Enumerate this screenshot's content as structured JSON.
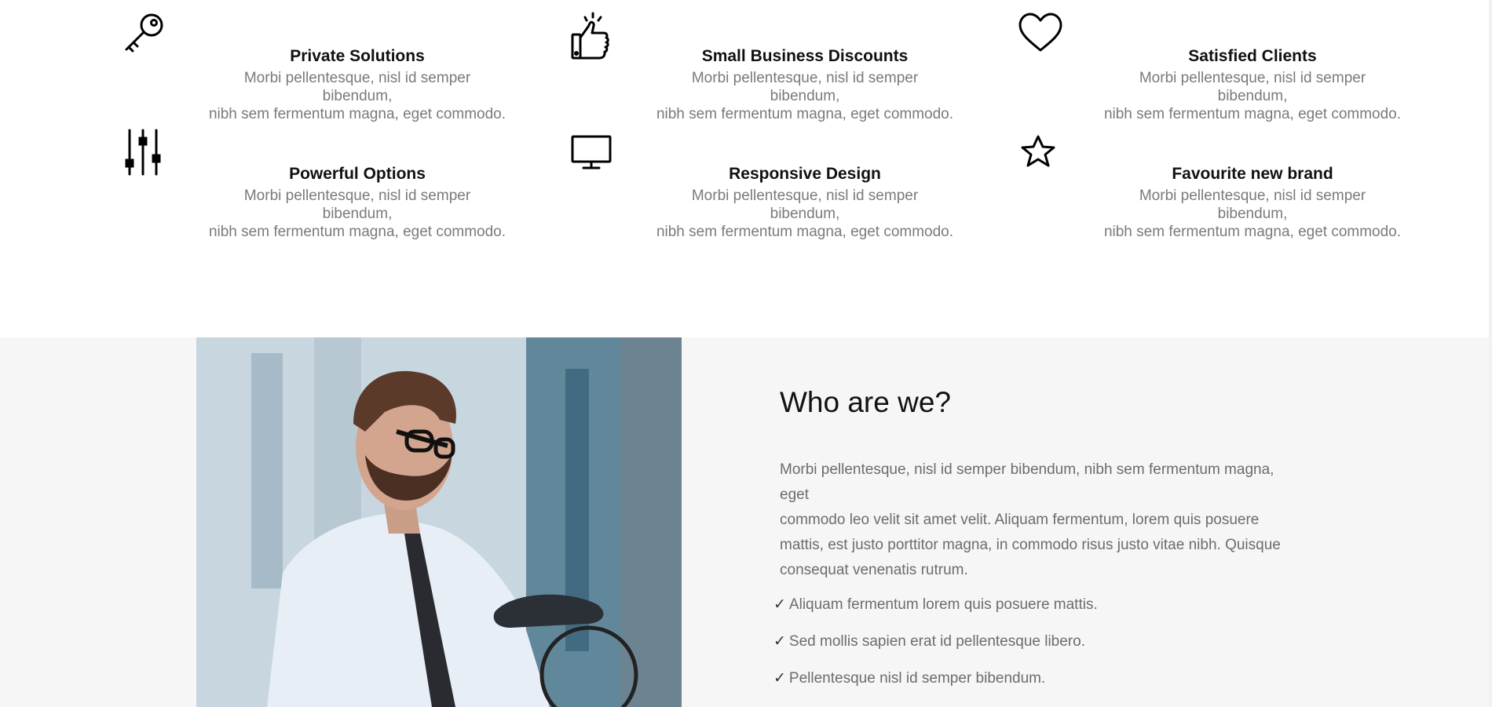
{
  "features": [
    {
      "icon": "key-icon",
      "title": "Private Solutions",
      "desc_line1": "Morbi pellentesque, nisl id semper bibendum,",
      "desc_line2": "nibh sem fermentum magna, eget commodo."
    },
    {
      "icon": "thumbs-up-icon",
      "title": "Small Business Discounts",
      "desc_line1": "Morbi pellentesque, nisl id semper bibendum,",
      "desc_line2": "nibh sem fermentum magna, eget commodo."
    },
    {
      "icon": "heart-icon",
      "title": "Satisfied Clients",
      "desc_line1": "Morbi pellentesque, nisl id semper bibendum,",
      "desc_line2": "nibh sem fermentum magna, eget commodo."
    },
    {
      "icon": "sliders-icon",
      "title": "Powerful Options",
      "desc_line1": "Morbi pellentesque, nisl id semper bibendum,",
      "desc_line2": "nibh sem fermentum magna, eget commodo."
    },
    {
      "icon": "monitor-icon",
      "title": "Responsive Design",
      "desc_line1": "Morbi pellentesque, nisl id semper bibendum,",
      "desc_line2": "nibh sem fermentum magna, eget commodo."
    },
    {
      "icon": "star-icon",
      "title": "Favourite new brand",
      "desc_line1": "Morbi pellentesque, nisl id semper bibendum,",
      "desc_line2": "nibh sem fermentum magna, eget commodo."
    }
  ],
  "about": {
    "title": "Who are we?",
    "body_lines": [
      "Morbi pellentesque, nisl id semper bibendum, nibh sem fermentum magna, eget",
      "commodo leo velit sit amet velit. Aliquam fermentum, lorem quis posuere",
      "mattis, est justo porttitor magna, in commodo risus justo vitae nibh. Quisque",
      "consequat venenatis rutrum."
    ],
    "check_mark": "✓",
    "checklist": [
      "Aliquam fermentum lorem quis posuere mattis.",
      "Sed mollis sapien erat id pellentesque libero.",
      "Pellentesque nisl id semper bibendum."
    ]
  },
  "colors": {
    "section_bg": "#f6f6f6",
    "body_text": "#6c6c6c",
    "muted_text": "#7a7a7a"
  }
}
